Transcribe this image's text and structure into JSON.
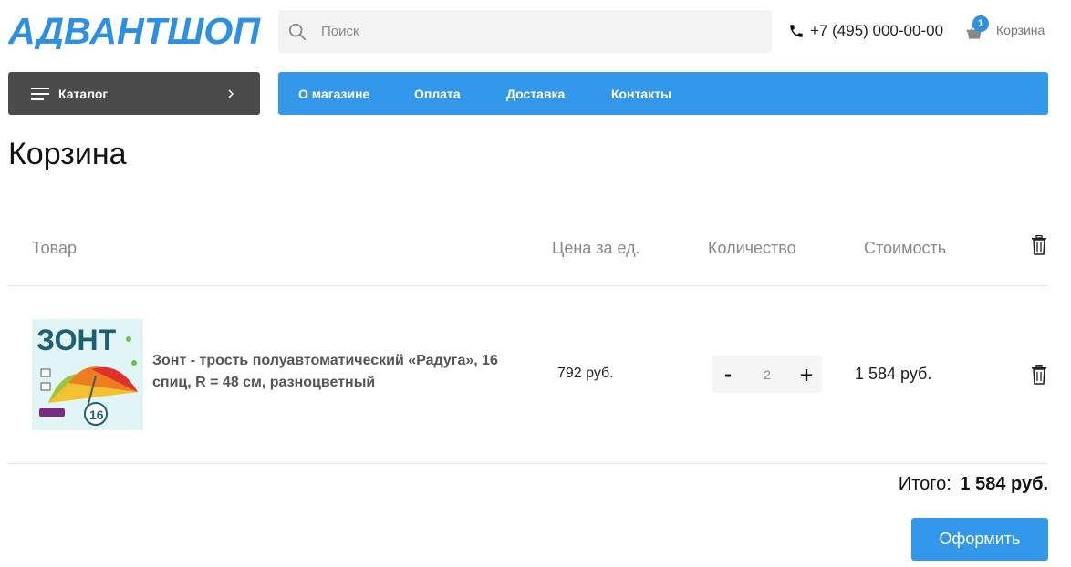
{
  "logo": {
    "text": "АДВАНТШОП"
  },
  "search": {
    "placeholder": "Поиск",
    "icon": "search-icon"
  },
  "header": {
    "phone": "+7 (495) 000-00-00",
    "cart_label": "Корзина",
    "cart_count": "1"
  },
  "catalog": {
    "label": "Каталог"
  },
  "nav": {
    "items": [
      {
        "label": "О магазине"
      },
      {
        "label": "Оплата"
      },
      {
        "label": "Доставка"
      },
      {
        "label": "Контакты"
      }
    ]
  },
  "page": {
    "title": "Корзина"
  },
  "table": {
    "columns": [
      "Товар",
      "Цена за ед.",
      "Количество",
      "Стоимость"
    ],
    "rows": [
      {
        "name": "Зонт - трость полуавтоматический «Радуга», 16 спиц, R = 48 см, разноцветный",
        "price": "792 руб.",
        "qty": "2",
        "total": "1 584 руб.",
        "image_text": "ЗОНТ",
        "image_badge": "16"
      }
    ]
  },
  "summary": {
    "label": "Итого:",
    "value": "1 584 руб."
  },
  "checkout": {
    "label": "Оформить"
  },
  "colors": {
    "accent": "#3498ea",
    "dark": "#4b4b4b",
    "badge": "#2f8fe0"
  }
}
